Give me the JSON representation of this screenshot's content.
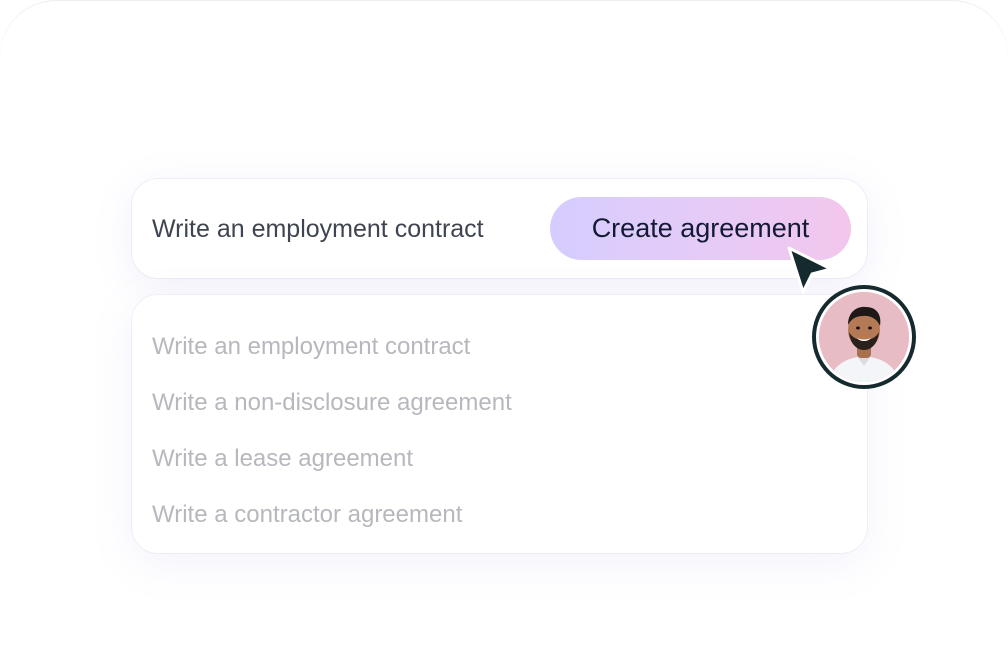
{
  "prompt": {
    "value": "Write an employment contract",
    "button_label": "Create agreement"
  },
  "suggestions": [
    "Write an employment contract",
    "Write a non-disclosure agreement",
    "Write a lease agreement",
    "Write a contractor agreement"
  ],
  "colors": {
    "button_gradient_start": "#d6ccff",
    "button_gradient_end": "#f3c6ec",
    "button_text": "#141a33",
    "suggestion_text": "#b6b8bd",
    "cursor": "#152a2e"
  },
  "icons": {
    "cursor": "pointer-cursor-icon",
    "avatar": "user-avatar"
  }
}
